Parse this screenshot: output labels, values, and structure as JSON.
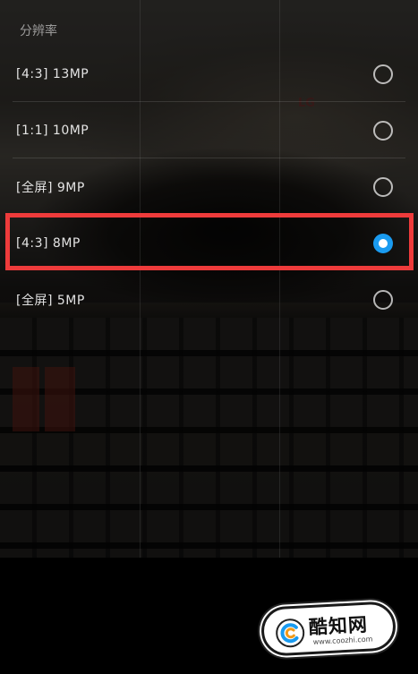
{
  "panel": {
    "title": "分辨率"
  },
  "options": [
    {
      "label": "[4:3] 13MP",
      "selected": false
    },
    {
      "label": "[1:1] 10MP",
      "selected": false
    },
    {
      "label": "[全屏] 9MP",
      "selected": false
    },
    {
      "label": "[4:3] 8MP",
      "selected": true
    },
    {
      "label": "[全屏] 5MP",
      "selected": false
    }
  ],
  "colors": {
    "accent": "#1a9bf0",
    "highlight": "#ee3b3b"
  },
  "watermark": {
    "name": "酷知网",
    "url": "www.coozhi.com"
  }
}
